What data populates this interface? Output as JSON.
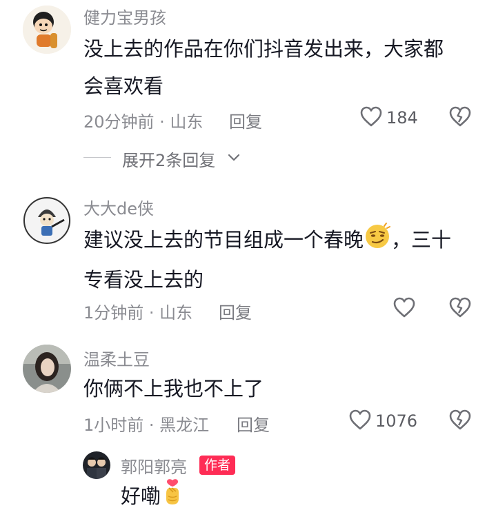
{
  "comments": [
    {
      "username": "健力宝男孩",
      "text_line1": "没上去的作品在你们抖音发出来，大家都",
      "text_line2": "会喜欢看",
      "time_location": "20分钟前 · 山东",
      "reply_label": "回复",
      "like_count": "184",
      "expand_label": "展开2条回复"
    },
    {
      "username": "大大de侠",
      "text_line1_a": "建议没上去的节目组成一个春晚",
      "text_line1_b": "，三十",
      "text_line2": "专看没上去的",
      "time_location": "1分钟前 · 山东",
      "reply_label": "回复"
    },
    {
      "username": "温柔土豆",
      "text_line1": "你俩不上我也不上了",
      "time_location": "1小时前 · 黑龙江",
      "reply_label": "回复",
      "like_count": "1076"
    }
  ],
  "reply": {
    "username": "郭阳郭亮",
    "badge": "作者",
    "text": "好嘞"
  },
  "colors": {
    "badge": "#fe2c55",
    "secondary_text": "#8a8b91",
    "primary_text": "#161823"
  },
  "icons": [
    "heart-outline-icon",
    "broken-heart-icon",
    "chevron-down-icon",
    "smirk-emoji",
    "finger-heart-emoji"
  ]
}
